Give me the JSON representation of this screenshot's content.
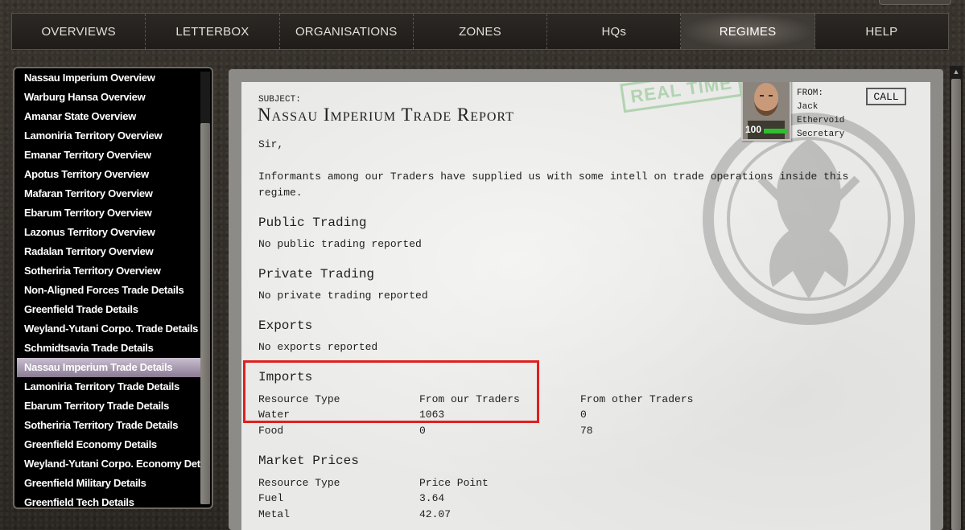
{
  "nav": {
    "items": [
      {
        "label": "OVERVIEWS"
      },
      {
        "label": "LETTERBOX"
      },
      {
        "label": "ORGANISATIONS"
      },
      {
        "label": "ZONES"
      },
      {
        "label": "HQs"
      },
      {
        "label": "REGIMES"
      },
      {
        "label": "HELP"
      }
    ],
    "active": "REGIMES"
  },
  "sidebar": {
    "items": [
      {
        "label": "Nassau Imperium Overview"
      },
      {
        "label": "Warburg Hansa Overview"
      },
      {
        "label": "Amanar State Overview"
      },
      {
        "label": "Lamoniria Territory Overview"
      },
      {
        "label": "Emanar Territory Overview"
      },
      {
        "label": "Apotus Territory Overview"
      },
      {
        "label": "Mafaran Territory Overview"
      },
      {
        "label": "Ebarum Territory Overview"
      },
      {
        "label": "Lazonus Territory Overview"
      },
      {
        "label": "Radalan Territory Overview"
      },
      {
        "label": "Sotheriria Territory Overview"
      },
      {
        "label": "Non-Aligned Forces Trade Details"
      },
      {
        "label": "Greenfield Trade Details"
      },
      {
        "label": "Weyland-Yutani Corpo. Trade Details"
      },
      {
        "label": "Schmidtsavia Trade Details"
      },
      {
        "label": "Nassau Imperium Trade Details"
      },
      {
        "label": "Lamoniria Territory Trade Details"
      },
      {
        "label": "Ebarum Territory Trade Details"
      },
      {
        "label": "Sotheriria Territory Trade Details"
      },
      {
        "label": "Greenfield Economy Details"
      },
      {
        "label": "Weyland-Yutani Corpo. Economy Details"
      },
      {
        "label": "Greenfield Military Details"
      },
      {
        "label": "Greenfield Tech Details"
      }
    ],
    "active": "Nassau Imperium Trade Details"
  },
  "letter": {
    "stamp": "REAL TIME",
    "subject_label": "SUBJECT:",
    "subject": "Nassau Imperium Trade Report",
    "greeting": "Sir,",
    "intro_line1": "Informants among our Traders have supplied us with some intell on trade operations inside this",
    "intro_line2": "regime.",
    "from": {
      "label": "FROM:",
      "first": "Jack",
      "last": "Ethervoid",
      "role": "Secretary",
      "health": "100"
    },
    "call_label": "CALL",
    "public": {
      "heading": "Public Trading",
      "text": "No public trading reported"
    },
    "private": {
      "heading": "Private Trading",
      "text": "No private trading reported"
    },
    "exports": {
      "heading": "Exports",
      "text": "No exports reported"
    },
    "imports": {
      "heading": "Imports",
      "columns": [
        "Resource Type",
        "From our Traders",
        "From other Traders"
      ],
      "rows": [
        [
          "Water",
          "1063",
          "0"
        ],
        [
          "Food",
          "0",
          "78"
        ]
      ]
    },
    "market": {
      "heading": "Market Prices",
      "columns": [
        "Resource Type",
        "Price Point"
      ],
      "rows": [
        [
          "Fuel",
          "3.64"
        ],
        [
          "Metal",
          "42.07"
        ]
      ]
    }
  },
  "icons": {
    "emblem": "faction-emblem-icon",
    "portrait": "secretary-portrait"
  }
}
